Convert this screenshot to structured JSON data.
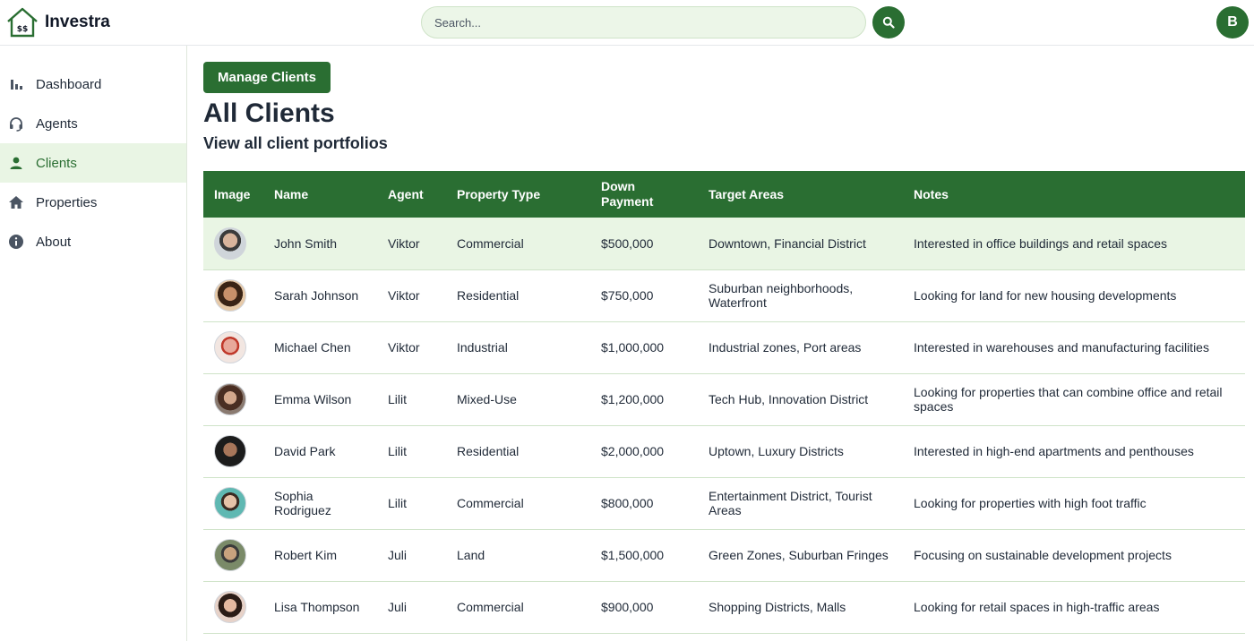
{
  "app": {
    "name": "Investra"
  },
  "search": {
    "placeholder": "Search..."
  },
  "user": {
    "initial": "B"
  },
  "sidebar": {
    "items": [
      {
        "label": "Dashboard",
        "icon": "bar-chart-icon",
        "active": false
      },
      {
        "label": "Agents",
        "icon": "headset-icon",
        "active": false
      },
      {
        "label": "Clients",
        "icon": "person-icon",
        "active": true
      },
      {
        "label": "Properties",
        "icon": "home-icon",
        "active": false
      },
      {
        "label": "About",
        "icon": "info-icon",
        "active": false
      }
    ]
  },
  "main": {
    "manage_button": "Manage Clients",
    "title": "All Clients",
    "subtitle": "View all client portfolios"
  },
  "table": {
    "headers": [
      "Image",
      "Name",
      "Agent",
      "Property Type",
      "Down Payment",
      "Target Areas",
      "Notes"
    ],
    "rows": [
      {
        "name": "John Smith",
        "agent": "Viktor",
        "type": "Commercial",
        "down": "$500,000",
        "areas": "Downtown, Financial District",
        "notes": "Interested in office buildings and retail spaces"
      },
      {
        "name": "Sarah Johnson",
        "agent": "Viktor",
        "type": "Residential",
        "down": "$750,000",
        "areas": "Suburban neighborhoods, Waterfront",
        "notes": "Looking for land for new housing developments"
      },
      {
        "name": "Michael Chen",
        "agent": "Viktor",
        "type": "Industrial",
        "down": "$1,000,000",
        "areas": "Industrial zones, Port areas",
        "notes": "Interested in warehouses and manufacturing facilities"
      },
      {
        "name": "Emma Wilson",
        "agent": "Lilit",
        "type": "Mixed-Use",
        "down": "$1,200,000",
        "areas": "Tech Hub, Innovation District",
        "notes": "Looking for properties that can combine office and retail spaces"
      },
      {
        "name": "David Park",
        "agent": "Lilit",
        "type": "Residential",
        "down": "$2,000,000",
        "areas": "Uptown, Luxury Districts",
        "notes": "Interested in high-end apartments and penthouses"
      },
      {
        "name": "Sophia Rodriguez",
        "agent": "Lilit",
        "type": "Commercial",
        "down": "$800,000",
        "areas": "Entertainment District, Tourist Areas",
        "notes": "Looking for properties with high foot traffic"
      },
      {
        "name": "Robert Kim",
        "agent": "Juli",
        "type": "Land",
        "down": "$1,500,000",
        "areas": "Green Zones, Suburban Fringes",
        "notes": "Focusing on sustainable development projects"
      },
      {
        "name": "Lisa Thompson",
        "agent": "Juli",
        "type": "Commercial",
        "down": "$900,000",
        "areas": "Shopping Districts, Malls",
        "notes": "Looking for retail spaces in high-traffic areas"
      }
    ]
  },
  "colors": {
    "primary": "#2a6e32",
    "highlight": "#e9f5e4",
    "search_bg": "#ecf6e8"
  }
}
